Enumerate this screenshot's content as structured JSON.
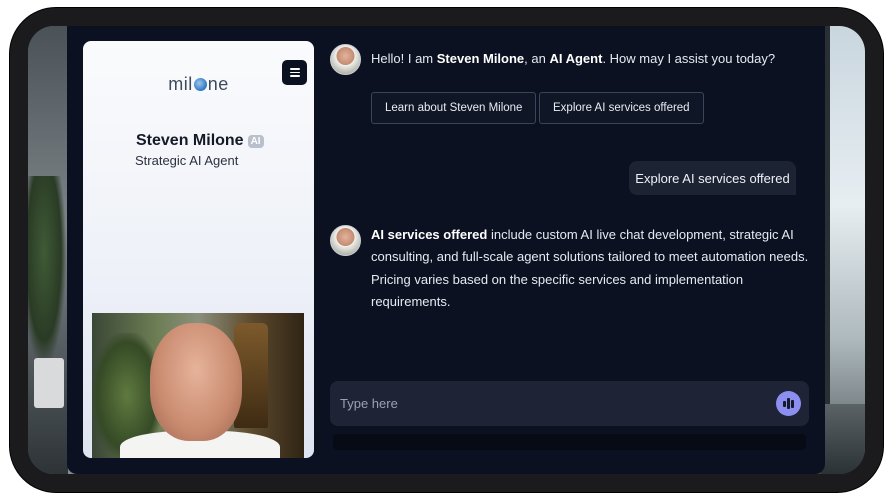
{
  "logo": {
    "prefix": "mil",
    "suffix": "ne"
  },
  "profile": {
    "name": "Steven Milone",
    "badge": "AI",
    "role": "Strategic AI Agent"
  },
  "chat": {
    "greeting": {
      "pre": "Hello! I am ",
      "name": "Steven Milone",
      "mid": ", an ",
      "agent": "AI Agent",
      "post": ". How may I assist you today?"
    },
    "suggestions": [
      "Learn about Steven Milone",
      "Explore AI services offered"
    ],
    "user_message": "Explore AI services offered",
    "reply": {
      "bold": "AI services offered",
      "line1": " include custom AI live chat development, strategic AI",
      "line2": "consulting, and full-scale agent solutions tailored to meet automation needs.",
      "line3": "Pricing varies based on the specific services and implementation",
      "line4": "requirements."
    }
  },
  "input": {
    "placeholder": "Type here",
    "value": ""
  },
  "colors": {
    "panel_bg": "#0b1120",
    "mic_accent": "#8d8ff0",
    "user_bubble": "#1c2333"
  },
  "icons": [
    "menu-icon",
    "voice-waveform-icon",
    "logo-globe-icon"
  ]
}
